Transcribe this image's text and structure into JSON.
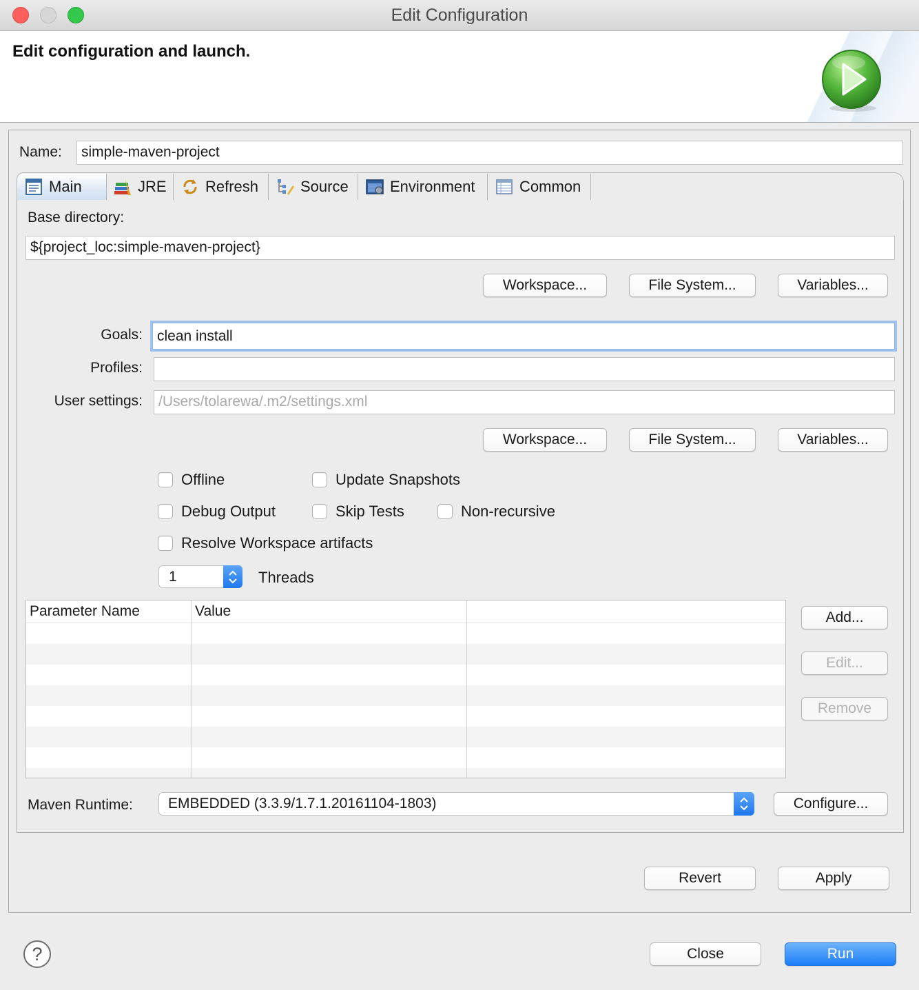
{
  "window": {
    "title": "Edit Configuration"
  },
  "banner": {
    "title": "Edit configuration and launch.",
    "icon": "run-launch-icon"
  },
  "name": {
    "label": "Name:",
    "value": "simple-maven-project"
  },
  "tabs": [
    {
      "label": "Main",
      "icon": "main-tab-icon",
      "active": true
    },
    {
      "label": "JRE",
      "icon": "jre-books-icon"
    },
    {
      "label": "Refresh",
      "icon": "refresh-icon"
    },
    {
      "label": "Source",
      "icon": "source-tree-icon"
    },
    {
      "label": "Environment",
      "icon": "environment-icon"
    },
    {
      "label": "Common",
      "icon": "common-table-icon"
    }
  ],
  "base_directory": {
    "label": "Base directory:",
    "value": "${project_loc:simple-maven-project}",
    "buttons": [
      "Workspace...",
      "File System...",
      "Variables..."
    ]
  },
  "goals": {
    "label": "Goals:",
    "value": "clean install"
  },
  "profiles": {
    "label": "Profiles:",
    "value": ""
  },
  "user_settings": {
    "label": "User settings:",
    "placeholder": "/Users/tolarewa/.m2/settings.xml",
    "buttons": [
      "Workspace...",
      "File System...",
      "Variables..."
    ]
  },
  "options": {
    "offline": "Offline",
    "update_snapshots": "Update Snapshots",
    "debug_output": "Debug Output",
    "skip_tests": "Skip Tests",
    "non_recursive": "Non-recursive",
    "resolve_workspace": "Resolve Workspace artifacts"
  },
  "threads": {
    "value": "1",
    "label": "Threads"
  },
  "parameters": {
    "columns": [
      "Parameter Name",
      "Value"
    ],
    "rows": [],
    "buttons": {
      "add": "Add...",
      "edit": "Edit...",
      "remove": "Remove"
    }
  },
  "maven_runtime": {
    "label": "Maven Runtime:",
    "selected": "EMBEDDED (3.3.9/1.7.1.20161104-1803)",
    "configure": "Configure..."
  },
  "actions": {
    "revert": "Revert",
    "apply": "Apply"
  },
  "footer": {
    "help": "?",
    "close": "Close",
    "run": "Run"
  },
  "colors": {
    "accent": "#1c7ef9",
    "focus_ring": "#9ec3ef"
  }
}
